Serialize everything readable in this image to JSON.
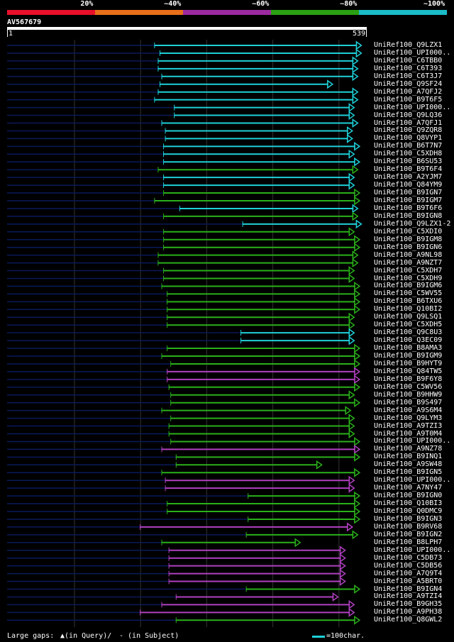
{
  "legend": {
    "segments": [
      {
        "label": "20%",
        "color": "#e8102a"
      },
      {
        "label": "~40%",
        "color": "#e8701a"
      },
      {
        "label": "~60%",
        "color": "#9b2aa0"
      },
      {
        "label": "~80%",
        "color": "#2aa012"
      },
      {
        "label": "~100%",
        "color": "#1abcc8"
      }
    ]
  },
  "query": {
    "name": "AV567679",
    "start": "1",
    "end": "539"
  },
  "colors": {
    "cyan": "#1ed0d8",
    "green": "#2ab01a",
    "purple": "#b040c0",
    "navy": "#0a1a5a"
  },
  "hits": [
    {
      "label": "UniRef100_Q9LZX1",
      "color": "cyan",
      "s": 0.41,
      "e": 0.985
    },
    {
      "label": "UniRef100_UPI000..",
      "color": "cyan",
      "s": 0.425,
      "e": 0.985
    },
    {
      "label": "UniRef100_C6TBB0",
      "color": "cyan",
      "s": 0.42,
      "e": 0.975
    },
    {
      "label": "UniRef100_C6T393",
      "color": "cyan",
      "s": 0.42,
      "e": 0.975
    },
    {
      "label": "UniRef100_C6T3J7",
      "color": "cyan",
      "s": 0.43,
      "e": 0.975
    },
    {
      "label": "UniRef100_Q9SF24",
      "color": "cyan",
      "s": 0.425,
      "e": 0.905
    },
    {
      "label": "UniRef100_A7QFJ2",
      "color": "cyan",
      "s": 0.42,
      "e": 0.975
    },
    {
      "label": "UniRef100_B9T6F5",
      "color": "cyan",
      "s": 0.41,
      "e": 0.975
    },
    {
      "label": "UniRef100_UPI000..",
      "color": "cyan",
      "s": 0.465,
      "e": 0.965
    },
    {
      "label": "UniRef100_Q9LQ36",
      "color": "cyan",
      "s": 0.465,
      "e": 0.965
    },
    {
      "label": "UniRef100_A7QFJ1",
      "color": "cyan",
      "s": 0.43,
      "e": 0.975
    },
    {
      "label": "UniRef100_Q9ZQR8",
      "color": "cyan",
      "s": 0.44,
      "e": 0.96
    },
    {
      "label": "UniRef100_Q8VYP1",
      "color": "cyan",
      "s": 0.44,
      "e": 0.96
    },
    {
      "label": "UniRef100_B6T7N7",
      "color": "cyan",
      "s": 0.435,
      "e": 0.98
    },
    {
      "label": "UniRef100_C5XDH8",
      "color": "cyan",
      "s": 0.435,
      "e": 0.965
    },
    {
      "label": "UniRef100_B6SU53",
      "color": "cyan",
      "s": 0.435,
      "e": 0.98
    },
    {
      "label": "UniRef100_B9T6F4",
      "color": "green",
      "s": 0.42,
      "e": 0.975
    },
    {
      "label": "UniRef100_A2YJM7",
      "color": "cyan",
      "s": 0.435,
      "e": 0.965
    },
    {
      "label": "UniRef100_Q84YM9",
      "color": "cyan",
      "s": 0.435,
      "e": 0.965
    },
    {
      "label": "UniRef100_B9IGN7",
      "color": "green",
      "s": 0.435,
      "e": 0.98
    },
    {
      "label": "UniRef100_B9IGM7",
      "color": "green",
      "s": 0.41,
      "e": 0.98
    },
    {
      "label": "UniRef100_B9T6F6",
      "color": "cyan",
      "s": 0.48,
      "e": 0.975
    },
    {
      "label": "UniRef100_B9IGN8",
      "color": "green",
      "s": 0.435,
      "e": 0.975
    },
    {
      "label": "UniRef100_Q9LZX1-2",
      "color": "cyan",
      "s": 0.655,
      "e": 0.985
    },
    {
      "label": "UniRef100_C5XDI0",
      "color": "green",
      "s": 0.435,
      "e": 0.965
    },
    {
      "label": "UniRef100_B9IGM8",
      "color": "green",
      "s": 0.435,
      "e": 0.98
    },
    {
      "label": "UniRef100_B9IGN6",
      "color": "green",
      "s": 0.435,
      "e": 0.98
    },
    {
      "label": "UniRef100_A9NL98",
      "color": "green",
      "s": 0.42,
      "e": 0.975
    },
    {
      "label": "UniRef100_A9NZT7",
      "color": "green",
      "s": 0.42,
      "e": 0.975
    },
    {
      "label": "UniRef100_C5XDH7",
      "color": "green",
      "s": 0.435,
      "e": 0.965
    },
    {
      "label": "UniRef100_C5XDH9",
      "color": "green",
      "s": 0.435,
      "e": 0.965
    },
    {
      "label": "UniRef100_B9IGM6",
      "color": "green",
      "s": 0.43,
      "e": 0.98
    },
    {
      "label": "UniRef100_C5WV55",
      "color": "green",
      "s": 0.445,
      "e": 0.98
    },
    {
      "label": "UniRef100_B6TXU6",
      "color": "green",
      "s": 0.445,
      "e": 0.98
    },
    {
      "label": "UniRef100_Q10BI2",
      "color": "green",
      "s": 0.445,
      "e": 0.98
    },
    {
      "label": "UniRef100_Q9LSQ1",
      "color": "green",
      "s": 0.445,
      "e": 0.965
    },
    {
      "label": "UniRef100_C5XDH5",
      "color": "green",
      "s": 0.445,
      "e": 0.965
    },
    {
      "label": "UniRef100_Q9C8U3",
      "color": "cyan",
      "s": 0.65,
      "e": 0.965
    },
    {
      "label": "UniRef100_Q3EC09",
      "color": "cyan",
      "s": 0.65,
      "e": 0.965
    },
    {
      "label": "UniRef100_B8AMA3",
      "color": "green",
      "s": 0.445,
      "e": 0.98
    },
    {
      "label": "UniRef100_B9IGM9",
      "color": "green",
      "s": 0.43,
      "e": 0.98
    },
    {
      "label": "UniRef100_B9HYT9",
      "color": "green",
      "s": 0.455,
      "e": 0.98
    },
    {
      "label": "UniRef100_Q84TW5",
      "color": "purple",
      "s": 0.445,
      "e": 0.98
    },
    {
      "label": "UniRef100_B9F6Y8",
      "color": "purple",
      "s": 0.445,
      "e": 0.98
    },
    {
      "label": "UniRef100_C5WV56",
      "color": "green",
      "s": 0.45,
      "e": 0.98
    },
    {
      "label": "UniRef100_B9HHW9",
      "color": "green",
      "s": 0.455,
      "e": 0.965
    },
    {
      "label": "UniRef100_B9S497",
      "color": "green",
      "s": 0.455,
      "e": 0.98
    },
    {
      "label": "UniRef100_A9S6M4",
      "color": "green",
      "s": 0.43,
      "e": 0.955
    },
    {
      "label": "UniRef100_Q9LYM3",
      "color": "green",
      "s": 0.455,
      "e": 0.965
    },
    {
      "label": "UniRef100_A9TZI3",
      "color": "green",
      "s": 0.45,
      "e": 0.965
    },
    {
      "label": "UniRef100_A9T0M4",
      "color": "green",
      "s": 0.45,
      "e": 0.965
    },
    {
      "label": "UniRef100_UPI000..",
      "color": "green",
      "s": 0.455,
      "e": 0.98
    },
    {
      "label": "UniRef100_A9NZ78",
      "color": "purple",
      "s": 0.43,
      "e": 0.98
    },
    {
      "label": "UniRef100_B9INQ1",
      "color": "green",
      "s": 0.47,
      "e": 0.98
    },
    {
      "label": "UniRef100_A9SW48",
      "color": "green",
      "s": 0.47,
      "e": 0.875
    },
    {
      "label": "UniRef100_B9IGN5",
      "color": "green",
      "s": 0.43,
      "e": 0.98
    },
    {
      "label": "UniRef100_UPI000..",
      "color": "purple",
      "s": 0.44,
      "e": 0.965
    },
    {
      "label": "UniRef100_A7NY47",
      "color": "purple",
      "s": 0.44,
      "e": 0.965
    },
    {
      "label": "UniRef100_B9IGN0",
      "color": "green",
      "s": 0.67,
      "e": 0.98
    },
    {
      "label": "UniRef100_Q10BI3",
      "color": "green",
      "s": 0.445,
      "e": 0.98
    },
    {
      "label": "UniRef100_Q0DMC9",
      "color": "green",
      "s": 0.445,
      "e": 0.98
    },
    {
      "label": "UniRef100_B9IGN3",
      "color": "green",
      "s": 0.67,
      "e": 0.98
    },
    {
      "label": "UniRef100_B9RV68",
      "color": "purple",
      "s": 0.37,
      "e": 0.96
    },
    {
      "label": "UniRef100_B9IGN2",
      "color": "green",
      "s": 0.665,
      "e": 0.975
    },
    {
      "label": "UniRef100_B8LPH7",
      "color": "green",
      "s": 0.43,
      "e": 0.815
    },
    {
      "label": "UniRef100_UPI000..",
      "color": "purple",
      "s": 0.45,
      "e": 0.94
    },
    {
      "label": "UniRef100_C5DB73",
      "color": "purple",
      "s": 0.45,
      "e": 0.94
    },
    {
      "label": "UniRef100_C5DB56",
      "color": "purple",
      "s": 0.45,
      "e": 0.94
    },
    {
      "label": "UniRef100_A7Q9T4",
      "color": "purple",
      "s": 0.45,
      "e": 0.94
    },
    {
      "label": "UniRef100_A5BRT0",
      "color": "purple",
      "s": 0.45,
      "e": 0.94
    },
    {
      "label": "UniRef100_B9IGN4",
      "color": "green",
      "s": 0.665,
      "e": 0.98
    },
    {
      "label": "UniRef100_A9TZI4",
      "color": "purple",
      "s": 0.47,
      "e": 0.92
    },
    {
      "label": "UniRef100_B9GH35",
      "color": "purple",
      "s": 0.43,
      "e": 0.965
    },
    {
      "label": "UniRef100_A9PH38",
      "color": "purple",
      "s": 0.37,
      "e": 0.965
    },
    {
      "label": "UniRef100_Q8GWL2",
      "color": "green",
      "s": 0.47,
      "e": 0.98
    }
  ],
  "footer": {
    "gaps": "Large gaps:",
    "query_gap": "(in Query)/",
    "subject_gap": "- (in Subject)",
    "scale": "=100char."
  }
}
